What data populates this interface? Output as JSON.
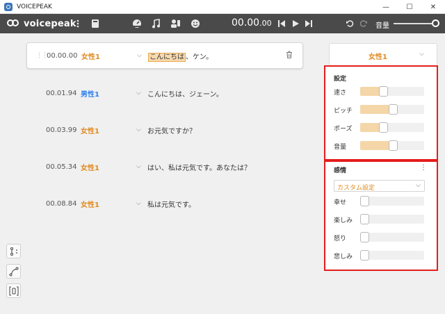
{
  "window": {
    "title": "VOICEPEAK",
    "minimize": "—",
    "maximize": "☐",
    "close": "✕"
  },
  "toolbar": {
    "logo": "voicepeak",
    "time_main": "00.00",
    "time_small": ".00",
    "volume_label": "音量",
    "volume_level": 0.85,
    "icons": [
      "kebab-icon",
      "book-icon",
      "speedometer-icon",
      "music-note-icon",
      "speaker-icon",
      "smiley-icon",
      "skip-back-icon",
      "play-icon",
      "skip-forward-icon",
      "undo-icon",
      "redo-icon"
    ]
  },
  "lines": [
    {
      "time": "00.00.00",
      "speaker": "女性1",
      "speaker_color": "#e08a1e",
      "text_highlight": "こんにちは",
      "text_rest": "、ケン。",
      "active": true
    },
    {
      "time": "00.01.94",
      "speaker": "男性1",
      "speaker_color": "#2f80ed",
      "text": "こんにちは、ジェーン。"
    },
    {
      "time": "00.03.99",
      "speaker": "女性1",
      "speaker_color": "#e08a1e",
      "text": "お元気ですか？"
    },
    {
      "time": "00.05.34",
      "speaker": "女性1",
      "speaker_color": "#e08a1e",
      "text": "はい、私は元気です。あなたは？"
    },
    {
      "time": "00.08.84",
      "speaker": "女性1",
      "speaker_color": "#e08a1e",
      "text": "私は元気です。"
    }
  ],
  "speaker_selector": {
    "value": "女性1"
  },
  "settings": {
    "title": "設定",
    "sliders": [
      {
        "label": "速さ",
        "level": 0.34
      },
      {
        "label": "ピッチ",
        "level": 0.52
      },
      {
        "label": "ポーズ",
        "level": 0.34
      },
      {
        "label": "音量",
        "level": 0.52
      }
    ]
  },
  "emotion": {
    "title": "感情",
    "preset": "カスタム設定",
    "sliders": [
      {
        "label": "幸せ",
        "level": 0.0
      },
      {
        "label": "楽しみ",
        "level": 0.0
      },
      {
        "label": "怒り",
        "level": 0.0
      },
      {
        "label": "悲しみ",
        "level": 0.0
      }
    ]
  },
  "colors": {
    "accent": "#e08a1e",
    "highlight_border": "#e41c1c",
    "toolbar": "#4a4a4a"
  }
}
